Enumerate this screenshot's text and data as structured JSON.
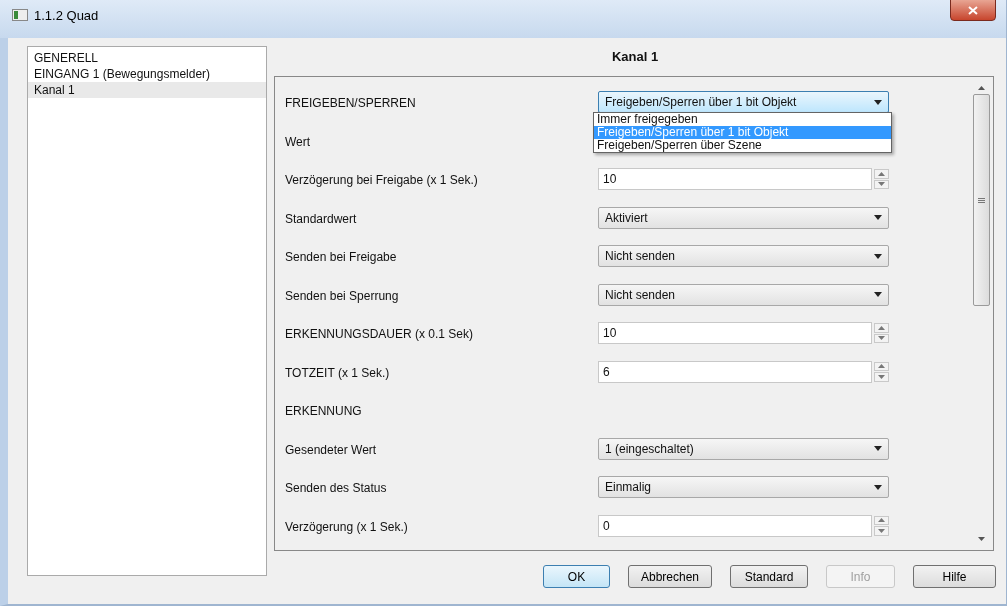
{
  "window": {
    "title": "1.1.2 Quad"
  },
  "tree": [
    {
      "label": "GENERELL",
      "selected": false
    },
    {
      "label": "EINGANG 1 (Bewegungsmelder)",
      "selected": false
    },
    {
      "label": "Kanal 1",
      "selected": true
    }
  ],
  "panel_title": "Kanal 1",
  "params": [
    {
      "kind": "select",
      "label": "FREIGEBEN/SPERREN",
      "value": "Freigeben/Sperren über 1 bit Objekt",
      "expanded": true,
      "options": [
        {
          "label": "Immer freigegeben",
          "selected": false
        },
        {
          "label": "Freigeben/Sperren über 1 bit Objekt",
          "selected": true
        },
        {
          "label": "Freigeben/Sperren über Szene",
          "selected": false
        }
      ]
    },
    {
      "kind": "label",
      "label": "Wert"
    },
    {
      "kind": "spin",
      "label": "Verzögerung bei Freigabe (x 1 Sek.)",
      "value": "10"
    },
    {
      "kind": "select",
      "label": "Standardwert",
      "value": "Aktiviert",
      "expanded": false
    },
    {
      "kind": "select",
      "label": "Senden bei Freigabe",
      "value": "Nicht senden",
      "expanded": false
    },
    {
      "kind": "select",
      "label": "Senden bei Sperrung",
      "value": "Nicht senden",
      "expanded": false
    },
    {
      "kind": "spin",
      "label": "ERKENNUNGSDAUER (x 0.1 Sek)",
      "value": "10"
    },
    {
      "kind": "spin",
      "label": "TOTZEIT (x 1 Sek.)",
      "value": "6"
    },
    {
      "kind": "label",
      "label": "ERKENNUNG"
    },
    {
      "kind": "select",
      "label": "Gesendeter Wert",
      "value": "1 (eingeschaltet)",
      "expanded": false
    },
    {
      "kind": "select",
      "label": "Senden des Status",
      "value": "Einmalig",
      "expanded": false
    },
    {
      "kind": "spin",
      "label": "Verzögerung (x 1 Sek.)",
      "value": "0"
    }
  ],
  "buttons": [
    {
      "label": "OK",
      "disabled": false,
      "default": true
    },
    {
      "label": "Abbrechen",
      "disabled": false,
      "default": false
    },
    {
      "label": "Standard",
      "disabled": false,
      "default": false
    },
    {
      "label": "Info",
      "disabled": true,
      "default": false
    },
    {
      "label": "Hilfe",
      "disabled": false,
      "default": false
    }
  ]
}
